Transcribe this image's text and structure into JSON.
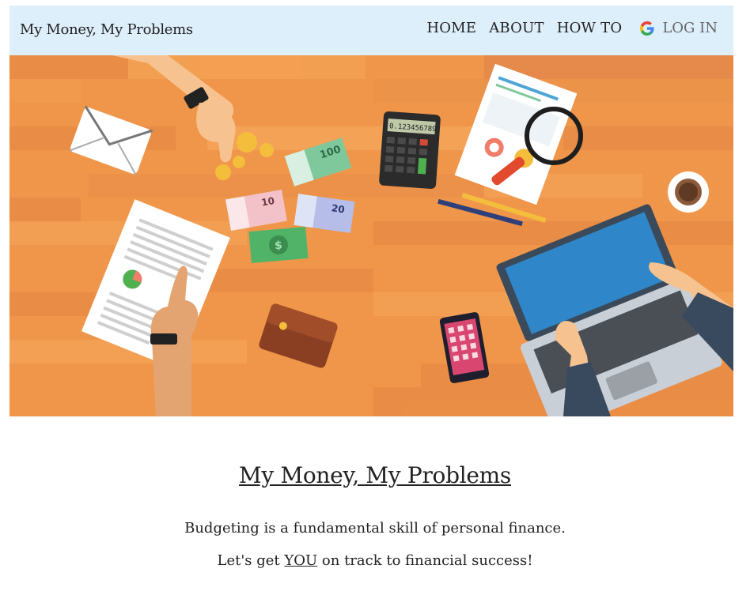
{
  "nav": {
    "brand": "My Money, My Problems",
    "links": [
      "HOME",
      "ABOUT",
      "HOW TO"
    ],
    "login_label": "LOG IN",
    "login_icon": "google-g-icon"
  },
  "hero": {
    "money_labels": [
      "100",
      "10",
      "20"
    ],
    "calculator_display": "0.123456789"
  },
  "main": {
    "title": "My Money, My Problems",
    "line1": "Budgeting is a fundamental skill of personal finance.",
    "line2_prefix": "Let's get ",
    "line2_emphasis": "YOU",
    "line2_suffix": " on track to financial success!"
  },
  "colors": {
    "navbar_bg": "#deeffc",
    "desk_orange": "#f0964a"
  }
}
